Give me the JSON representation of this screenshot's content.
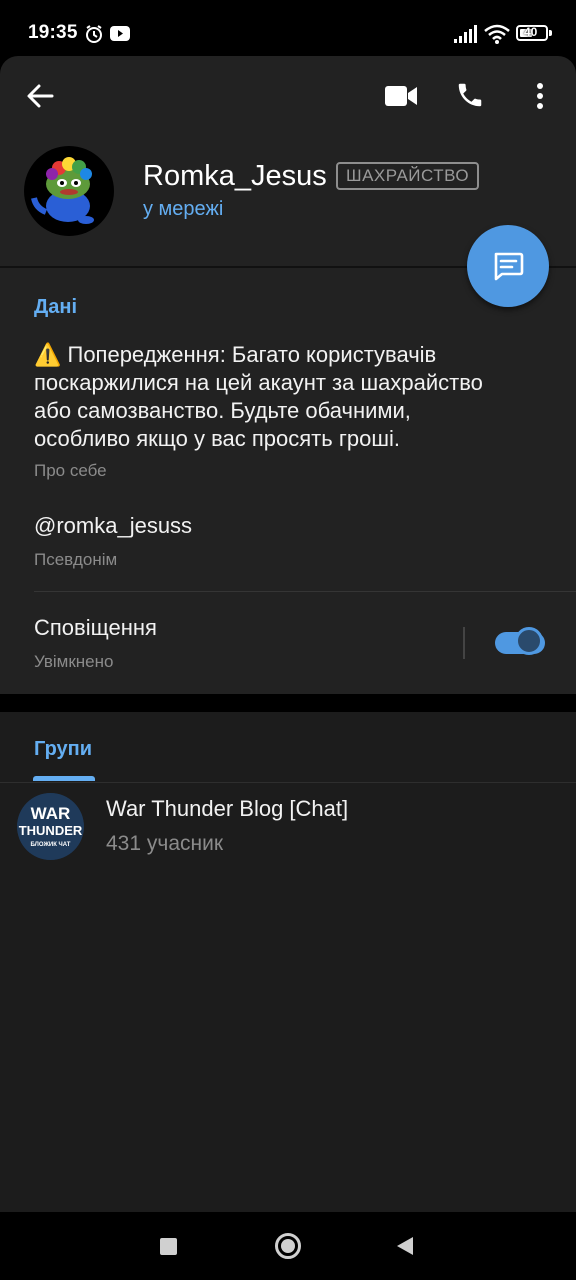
{
  "status_bar": {
    "time": "19:35",
    "battery": "40",
    "icons": [
      "alarm-icon",
      "youtube-icon",
      "signal-icon",
      "wifi-icon",
      "battery-icon"
    ]
  },
  "header": {
    "back_icon": "arrow-left-icon",
    "actions": [
      "video-call-icon",
      "phone-icon",
      "more-vertical-icon"
    ]
  },
  "profile": {
    "name": "Romka_Jesus",
    "badge": "ШАХРАЙСТВО",
    "status": "у мережі",
    "fab_icon": "message-icon"
  },
  "info": {
    "section_title": "Дані",
    "bio_lines": [
      "⚠️ Попередження: Багато користувачів",
      "поскаржилися на цей акаунт за шахрайство",
      "або самозванство. Будьте обачними,",
      "особливо якщо у вас просять гроші."
    ],
    "bio_caption": "Про себе",
    "username": "@romka_jesuss",
    "username_caption": "Псевдонім",
    "notifications_title": "Сповіщення",
    "notifications_value": "Увімкнено",
    "notifications_enabled": true
  },
  "groups": {
    "tab_label": "Групи",
    "items": [
      {
        "name": "War Thunder Blog [Chat]",
        "members": "431 учасник",
        "avatar_text": [
          "WAR",
          "THUNDER",
          "БЛОЖИК ЧАТ"
        ]
      }
    ]
  },
  "nav_bar": {
    "buttons": [
      "recents-square-icon",
      "home-circle-icon",
      "back-triangle-icon"
    ]
  },
  "colors": {
    "accent": "#64aef2",
    "fab": "#4f98e1",
    "surface": "#222222",
    "background": "#1c1c1c"
  }
}
